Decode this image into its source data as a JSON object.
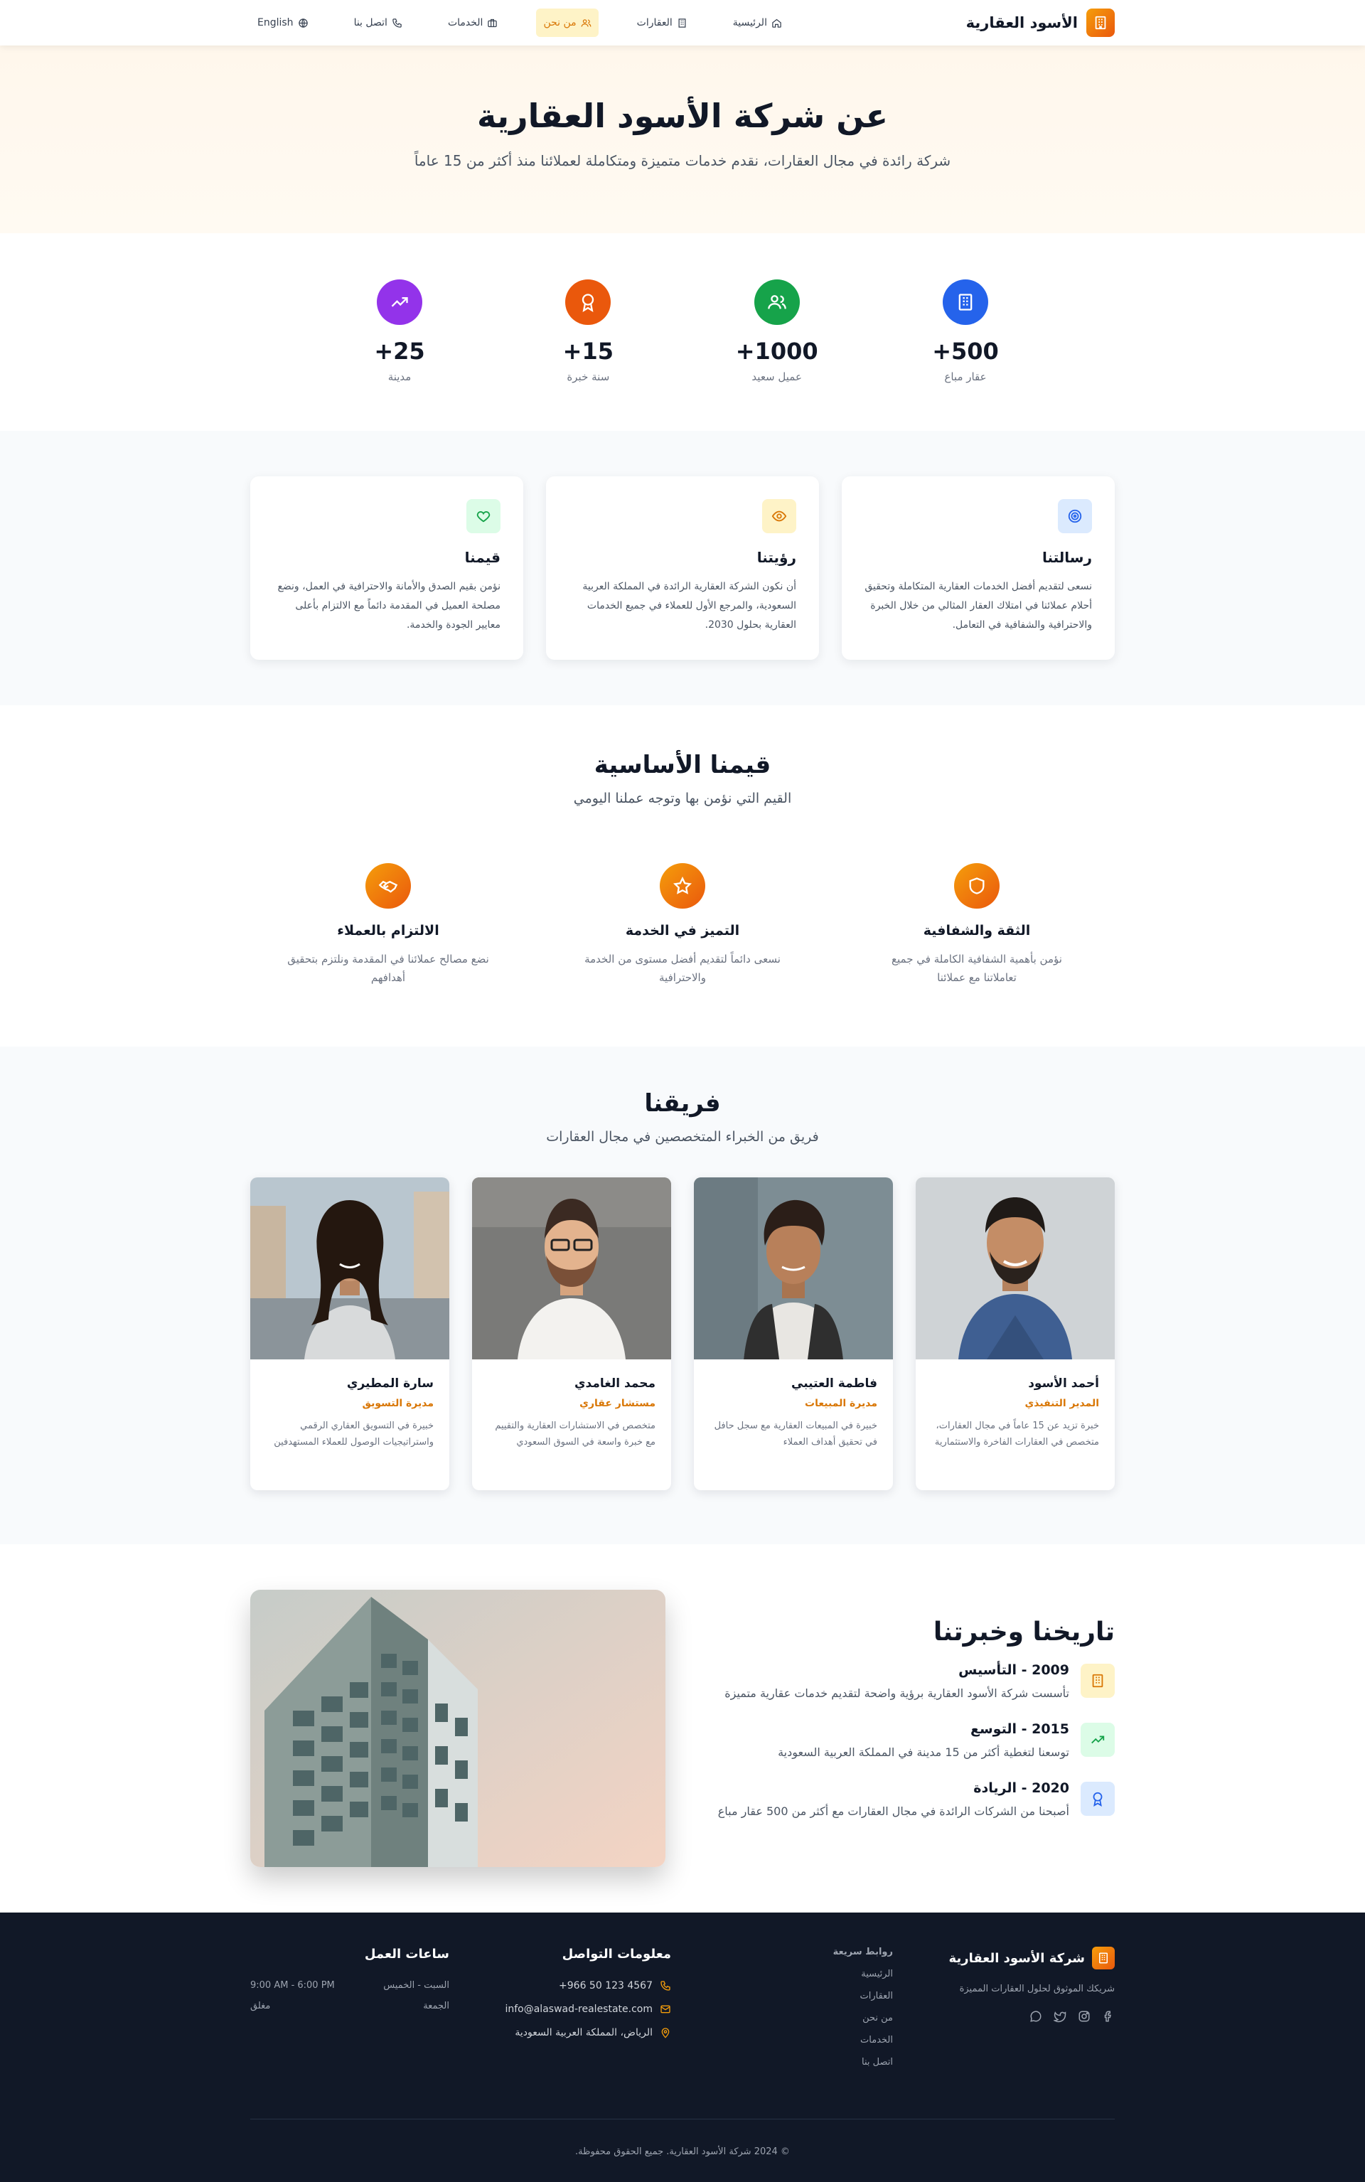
{
  "brand": {
    "name": "الأسود العقارية"
  },
  "nav": {
    "items": [
      {
        "label": "الرئيسية",
        "icon": "home-icon"
      },
      {
        "label": "العقارات",
        "icon": "building-icon"
      },
      {
        "label": "من نحن",
        "icon": "users-icon",
        "active": true
      },
      {
        "label": "الخدمات",
        "icon": "briefcase-icon"
      },
      {
        "label": "اتصل بنا",
        "icon": "phone-icon"
      }
    ],
    "language": "English"
  },
  "hero": {
    "title": "عن شركة الأسود العقارية",
    "subtitle": "شركة رائدة في مجال العقارات، نقدم خدمات متميزة ومتكاملة لعملائنا منذ أكثر من 15 عاماً"
  },
  "stats": [
    {
      "value": "+500",
      "label": "عقار مباع",
      "color": "#2563eb"
    },
    {
      "value": "+1000",
      "label": "عميل سعيد",
      "color": "#16a34a"
    },
    {
      "value": "+15",
      "label": "سنة خبرة",
      "color": "#ea580c"
    },
    {
      "value": "+25",
      "label": "مدينة",
      "color": "#9333ea"
    }
  ],
  "mission": [
    {
      "title": "رسالتنا",
      "text": "نسعى لتقديم أفضل الخدمات العقارية المتكاملة وتحقيق أحلام عملائنا في امتلاك العقار المثالي من خلال الخبرة والاحترافية والشفافية في التعامل."
    },
    {
      "title": "رؤيتنا",
      "text": "أن نكون الشركة العقارية الرائدة في المملكة العربية السعودية، والمرجع الأول للعملاء في جميع الخدمات العقارية بحلول 2030."
    },
    {
      "title": "قيمنا",
      "text": "نؤمن بقيم الصدق والأمانة والاحترافية في العمل، ونضع مصلحة العميل في المقدمة دائماً مع الالتزام بأعلى معايير الجودة والخدمة."
    }
  ],
  "values": {
    "title": "قيمنا الأساسية",
    "subtitle": "القيم التي نؤمن بها وتوجه عملنا اليومي",
    "items": [
      {
        "title": "الثقة والشفافية",
        "text": "نؤمن بأهمية الشفافية الكاملة في جميع تعاملاتنا مع عملائنا"
      },
      {
        "title": "التميز في الخدمة",
        "text": "نسعى دائماً لتقديم أفضل مستوى من الخدمة والاحترافية"
      },
      {
        "title": "الالتزام بالعملاء",
        "text": "نضع مصالح عملائنا في المقدمة ونلتزم بتحقيق أهدافهم"
      }
    ]
  },
  "team": {
    "title": "فريقنا",
    "subtitle": "فريق من الخبراء المتخصصين في مجال العقارات",
    "members": [
      {
        "name": "أحمد الأسود",
        "role": "المدير التنفيذي",
        "bio": "خبرة تزيد عن 15 عاماً في مجال العقارات، متخصص في العقارات الفاخرة والاستثمارية"
      },
      {
        "name": "فاطمة العتيبي",
        "role": "مديرة المبيعات",
        "bio": "خبيرة في المبيعات العقارية مع سجل حافل في تحقيق أهداف العملاء"
      },
      {
        "name": "محمد الغامدي",
        "role": "مستشار عقاري",
        "bio": "متخصص في الاستشارات العقارية والتقييم مع خبرة واسعة في السوق السعودي"
      },
      {
        "name": "سارة المطيري",
        "role": "مديرة التسويق",
        "bio": "خبيرة في التسويق العقاري الرقمي واستراتيجيات الوصول للعملاء المستهدفين"
      }
    ]
  },
  "history": {
    "title": "تاريخنا وخبرتنا",
    "items": [
      {
        "year": "2009 - التأسيس",
        "text": "تأسست شركة الأسود العقارية برؤية واضحة لتقديم خدمات عقارية متميزة"
      },
      {
        "year": "2015 - التوسع",
        "text": "توسعنا لتغطية أكثر من 15 مدينة في المملكة العربية السعودية"
      },
      {
        "year": "2020 - الريادة",
        "text": "أصبحنا من الشركات الرائدة في مجال العقارات مع أكثر من 500 عقار مباع"
      }
    ]
  },
  "footer": {
    "brand": "شركة الأسود العقارية",
    "tagline": "شريكك الموثوق لحلول العقارات المميزة",
    "links_title": "روابط سريعة",
    "links": [
      "الرئيسية",
      "العقارات",
      "من نحن",
      "الخدمات",
      "اتصل بنا"
    ],
    "contact_title": "معلومات التواصل",
    "contact": {
      "phone": "+966 50 123 4567",
      "email": "info@alaswad-realestate.com",
      "address": "الرياض، المملكة العربية السعودية"
    },
    "hours_title": "ساعات العمل",
    "hours": [
      {
        "day": "السبت - الخميس",
        "time": "9:00 AM - 6:00 PM"
      },
      {
        "day": "الجمعة",
        "time": "مغلق"
      }
    ],
    "copyright": "© 2024 شركة الأسود العقارية. جميع الحقوق محفوظة."
  }
}
